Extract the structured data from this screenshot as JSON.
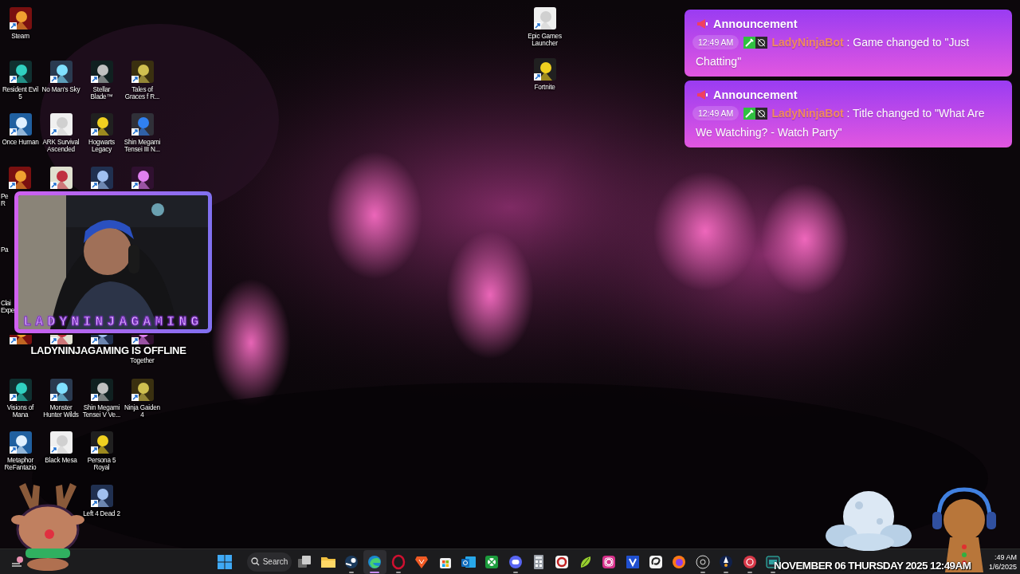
{
  "desktop": {
    "grid": [
      [
        {
          "kind": "shortcut",
          "label": "Steam"
        }
      ],
      [
        {
          "kind": "shortcut",
          "label": "Resident Evil 5"
        },
        {
          "kind": "shortcut",
          "label": "No Man's Sky"
        },
        {
          "kind": "shortcut",
          "label": "Stellar Blade™"
        },
        {
          "kind": "shortcut",
          "label": "Tales of Graces f R..."
        }
      ],
      [
        {
          "kind": "shortcut",
          "label": "Once Human"
        },
        {
          "kind": "shortcut",
          "label": "ARK Survival Ascended"
        },
        {
          "kind": "shortcut",
          "label": "Hogwarts Legacy"
        },
        {
          "kind": "shortcut",
          "label": "Shin Megami Tensei III N..."
        }
      ],
      [
        {
          "kind": "clipped",
          "label": "Pe R"
        },
        {
          "kind": "shortcut"
        },
        {
          "kind": "shortcut"
        },
        {
          "kind": "shortcut"
        }
      ],
      [
        {
          "kind": "label-fragment",
          "label": "Pa"
        }
      ],
      [
        {
          "kind": "label-fragment",
          "label": "Clai Expe"
        }
      ],
      [
        {
          "kind": "partial"
        },
        {
          "kind": "partial"
        },
        {
          "kind": "partial"
        },
        {
          "kind": "partial",
          "label": "Together"
        }
      ],
      [
        {
          "kind": "shortcut",
          "label": "Visions of Mana"
        },
        {
          "kind": "shortcut",
          "label": "Monster Hunter Wilds"
        },
        {
          "kind": "shortcut",
          "label": "Shin Megami Tensei V Ve..."
        },
        {
          "kind": "shortcut",
          "label": "Ninja Gaiden 4"
        }
      ],
      [
        {
          "kind": "shortcut",
          "label": "Metaphor ReFantazio"
        },
        {
          "kind": "shortcut",
          "label": "Black Mesa"
        },
        {
          "kind": "shortcut",
          "label": "Persona 5 Royal"
        }
      ],
      [
        {
          "kind": "empty"
        },
        {
          "kind": "empty"
        },
        {
          "kind": "shortcut",
          "label": "Left 4 Dead 2"
        }
      ]
    ],
    "side_column": [
      {
        "kind": "shortcut",
        "label": "Epic Games Launcher"
      },
      {
        "kind": "shortcut",
        "label": "Fortnite"
      }
    ]
  },
  "webcam": {
    "channel_name": "LADYNINJAGAMING",
    "status": "LADYNINJAGAMING IS OFFLINE"
  },
  "announcements": [
    {
      "title": "Announcement",
      "time": "12:49 AM",
      "user": "LadyNinjaBot",
      "message": ": Game changed to \"Just Chatting\""
    },
    {
      "title": "Announcement",
      "time": "12:49 AM",
      "user": "LadyNinjaBot",
      "message": ": Title changed to \"What Are We Watching? - Watch Party\""
    }
  ],
  "taskbar": {
    "apps": [
      {
        "kind": "start",
        "running": false,
        "selected": false
      },
      {
        "kind": "search",
        "label": "Search",
        "running": false,
        "selected": false
      },
      {
        "kind": "task-view",
        "running": false,
        "selected": false
      },
      {
        "kind": "folder",
        "running": false,
        "selected": false
      },
      {
        "kind": "steam",
        "running": true,
        "selected": false
      },
      {
        "kind": "edge",
        "running": true,
        "selected": true
      },
      {
        "kind": "opera",
        "running": true,
        "selected": false
      },
      {
        "kind": "brave",
        "running": false,
        "selected": false
      },
      {
        "kind": "store",
        "running": false,
        "selected": false
      },
      {
        "kind": "outlook",
        "running": false,
        "selected": false
      },
      {
        "kind": "xbox",
        "running": false,
        "selected": false
      },
      {
        "kind": "discord",
        "running": true,
        "selected": false
      },
      {
        "kind": "calculator",
        "running": false,
        "selected": false
      },
      {
        "kind": "g-app",
        "running": false,
        "selected": false
      },
      {
        "kind": "lime-app",
        "running": false,
        "selected": false
      },
      {
        "kind": "instagram",
        "running": false,
        "selected": false
      },
      {
        "kind": "v-app",
        "running": false,
        "selected": false
      },
      {
        "kind": "clip-app",
        "running": false,
        "selected": false
      },
      {
        "kind": "firefox",
        "running": false,
        "selected": false
      },
      {
        "kind": "obs",
        "running": true,
        "selected": false
      },
      {
        "kind": "rocket-app",
        "running": true,
        "selected": false
      },
      {
        "kind": "co-app",
        "running": true,
        "selected": false
      },
      {
        "kind": "bg-app",
        "running": true,
        "selected": false
      }
    ],
    "clock": {
      "time": ":49 AM",
      "date": "1/6/2025"
    }
  },
  "date_banner": "NOVEMBER 06 THURSDAY 2025 12:49AM"
}
